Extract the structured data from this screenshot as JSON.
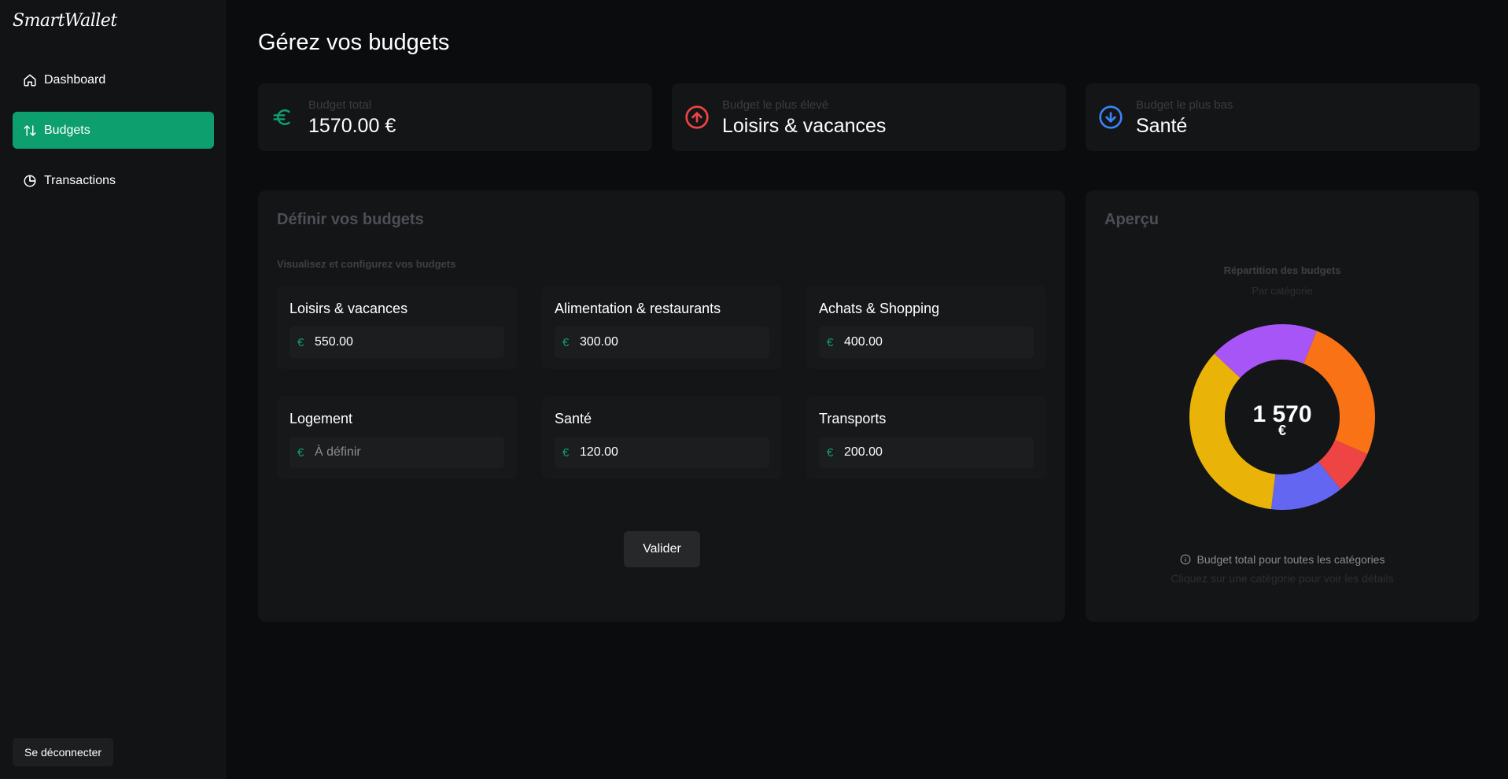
{
  "app": {
    "name": "SmartWallet"
  },
  "sidebar": {
    "items": [
      {
        "label": "Dashboard",
        "icon": "home-icon"
      },
      {
        "label": "Budgets",
        "icon": "arrows-up-down-icon"
      },
      {
        "label": "Transactions",
        "icon": "pie-chart-icon"
      }
    ],
    "logout_label": "Se déconnecter"
  },
  "header": {
    "title": "Gérez vos budgets"
  },
  "stats": [
    {
      "label": "Budget total",
      "value": "1570.00 €",
      "icon": "euro-icon",
      "color": "#0e9f6e"
    },
    {
      "label": "Budget le plus élevé",
      "value": "Loisirs & vacances",
      "icon": "arrow-up-circle-icon",
      "color": "#ef4444"
    },
    {
      "label": "Budget le plus bas",
      "value": "Santé",
      "icon": "arrow-down-circle-icon",
      "color": "#3b82f6"
    }
  ],
  "budgets_panel": {
    "title": "Définir vos budgets",
    "subtitle": "Visualisez et configurez vos budgets",
    "currency_symbol": "€",
    "categories": [
      {
        "name": "Loisirs & vacances",
        "value": "550.00",
        "placeholder": ""
      },
      {
        "name": "Alimentation & restaurants",
        "value": "300.00",
        "placeholder": ""
      },
      {
        "name": "Achats & Shopping",
        "value": "400.00",
        "placeholder": ""
      },
      {
        "name": "Logement",
        "value": "",
        "placeholder": "À définir"
      },
      {
        "name": "Santé",
        "value": "120.00",
        "placeholder": ""
      },
      {
        "name": "Transports",
        "value": "200.00",
        "placeholder": ""
      }
    ],
    "submit_label": "Valider"
  },
  "overview_panel": {
    "title": "Aperçu",
    "chart_title": "Répartition des budgets",
    "chart_subtitle": "Par catégorie",
    "center_value": "1 570",
    "center_unit": "€",
    "note": "Budget total pour toutes les catégories",
    "hint": "Cliquez sur une catégorie pour voir les détails"
  },
  "chart_data": {
    "type": "pie",
    "title": "Répartition des budgets",
    "subtitle": "Par catégorie",
    "categories": [
      "Achats & Shopping",
      "Santé",
      "Transports",
      "Loisirs & vacances",
      "Alimentation & restaurants"
    ],
    "values": [
      400,
      120,
      200,
      550,
      300
    ],
    "colors": [
      "#f97316",
      "#ef4444",
      "#6366f1",
      "#eab308",
      "#a855f7"
    ],
    "total": 1570
  }
}
